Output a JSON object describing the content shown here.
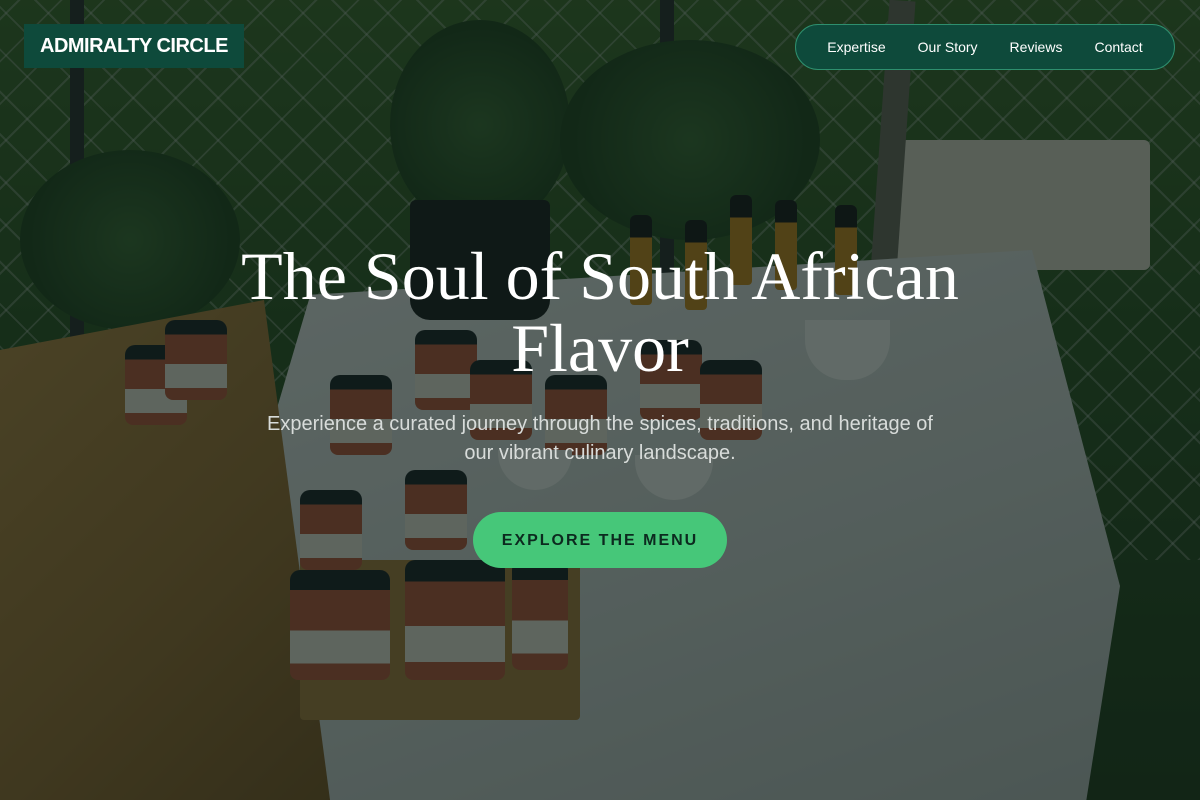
{
  "brand": {
    "name": "ADMIRALTY CIRCLE"
  },
  "nav": {
    "items": [
      {
        "label": "Expertise"
      },
      {
        "label": "Our Story"
      },
      {
        "label": "Reviews"
      },
      {
        "label": "Contact"
      }
    ]
  },
  "hero": {
    "title": "The Soul of South African Flavor",
    "subtitle": "Experience a curated journey through the spices, traditions, and heritage of our vibrant culinary landscape.",
    "cta_label": "EXPLORE THE MENU"
  },
  "colors": {
    "brand_green": "#0e4a3b",
    "cta_green": "#46c779",
    "text_light": "#ffffff"
  }
}
